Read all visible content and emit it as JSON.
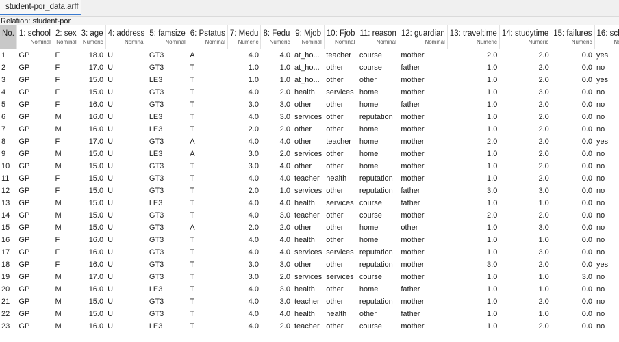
{
  "tab": {
    "label": "student-por_data.arff"
  },
  "relation": "Relation: student-por",
  "columns": [
    {
      "name": "No.",
      "type": ""
    },
    {
      "name": "1: school",
      "type": "Nominal"
    },
    {
      "name": "2: sex",
      "type": "Nominal"
    },
    {
      "name": "3: age",
      "type": "Numeric"
    },
    {
      "name": "4: address",
      "type": "Nominal"
    },
    {
      "name": "5: famsize",
      "type": "Nominal"
    },
    {
      "name": "6: Pstatus",
      "type": "Nominal"
    },
    {
      "name": "7: Medu",
      "type": "Numeric"
    },
    {
      "name": "8: Fedu",
      "type": "Numeric"
    },
    {
      "name": "9: Mjob",
      "type": "Nominal"
    },
    {
      "name": "10: Fjob",
      "type": "Nominal"
    },
    {
      "name": "11: reason",
      "type": "Nominal"
    },
    {
      "name": "12: guardian",
      "type": "Nominal"
    },
    {
      "name": "13: traveltime",
      "type": "Numeric"
    },
    {
      "name": "14: studytime",
      "type": "Numeric"
    },
    {
      "name": "15: failures",
      "type": "Numeric"
    },
    {
      "name": "16: scho",
      "type": "Nomi"
    }
  ],
  "rows": [
    [
      "1",
      "GP",
      "F",
      "18.0",
      "U",
      "GT3",
      "A",
      "4.0",
      "4.0",
      "at_ho...",
      "teacher",
      "course",
      "mother",
      "2.0",
      "2.0",
      "0.0",
      "yes"
    ],
    [
      "2",
      "GP",
      "F",
      "17.0",
      "U",
      "GT3",
      "T",
      "1.0",
      "1.0",
      "at_ho...",
      "other",
      "course",
      "father",
      "1.0",
      "2.0",
      "0.0",
      "no"
    ],
    [
      "3",
      "GP",
      "F",
      "15.0",
      "U",
      "LE3",
      "T",
      "1.0",
      "1.0",
      "at_ho...",
      "other",
      "other",
      "mother",
      "1.0",
      "2.0",
      "0.0",
      "yes"
    ],
    [
      "4",
      "GP",
      "F",
      "15.0",
      "U",
      "GT3",
      "T",
      "4.0",
      "2.0",
      "health",
      "services",
      "home",
      "mother",
      "1.0",
      "3.0",
      "0.0",
      "no"
    ],
    [
      "5",
      "GP",
      "F",
      "16.0",
      "U",
      "GT3",
      "T",
      "3.0",
      "3.0",
      "other",
      "other",
      "home",
      "father",
      "1.0",
      "2.0",
      "0.0",
      "no"
    ],
    [
      "6",
      "GP",
      "M",
      "16.0",
      "U",
      "LE3",
      "T",
      "4.0",
      "3.0",
      "services",
      "other",
      "reputation",
      "mother",
      "1.0",
      "2.0",
      "0.0",
      "no"
    ],
    [
      "7",
      "GP",
      "M",
      "16.0",
      "U",
      "LE3",
      "T",
      "2.0",
      "2.0",
      "other",
      "other",
      "home",
      "mother",
      "1.0",
      "2.0",
      "0.0",
      "no"
    ],
    [
      "8",
      "GP",
      "F",
      "17.0",
      "U",
      "GT3",
      "A",
      "4.0",
      "4.0",
      "other",
      "teacher",
      "home",
      "mother",
      "2.0",
      "2.0",
      "0.0",
      "yes"
    ],
    [
      "9",
      "GP",
      "M",
      "15.0",
      "U",
      "LE3",
      "A",
      "3.0",
      "2.0",
      "services",
      "other",
      "home",
      "mother",
      "1.0",
      "2.0",
      "0.0",
      "no"
    ],
    [
      "10",
      "GP",
      "M",
      "15.0",
      "U",
      "GT3",
      "T",
      "3.0",
      "4.0",
      "other",
      "other",
      "home",
      "mother",
      "1.0",
      "2.0",
      "0.0",
      "no"
    ],
    [
      "11",
      "GP",
      "F",
      "15.0",
      "U",
      "GT3",
      "T",
      "4.0",
      "4.0",
      "teacher",
      "health",
      "reputation",
      "mother",
      "1.0",
      "2.0",
      "0.0",
      "no"
    ],
    [
      "12",
      "GP",
      "F",
      "15.0",
      "U",
      "GT3",
      "T",
      "2.0",
      "1.0",
      "services",
      "other",
      "reputation",
      "father",
      "3.0",
      "3.0",
      "0.0",
      "no"
    ],
    [
      "13",
      "GP",
      "M",
      "15.0",
      "U",
      "LE3",
      "T",
      "4.0",
      "4.0",
      "health",
      "services",
      "course",
      "father",
      "1.0",
      "1.0",
      "0.0",
      "no"
    ],
    [
      "14",
      "GP",
      "M",
      "15.0",
      "U",
      "GT3",
      "T",
      "4.0",
      "3.0",
      "teacher",
      "other",
      "course",
      "mother",
      "2.0",
      "2.0",
      "0.0",
      "no"
    ],
    [
      "15",
      "GP",
      "M",
      "15.0",
      "U",
      "GT3",
      "A",
      "2.0",
      "2.0",
      "other",
      "other",
      "home",
      "other",
      "1.0",
      "3.0",
      "0.0",
      "no"
    ],
    [
      "16",
      "GP",
      "F",
      "16.0",
      "U",
      "GT3",
      "T",
      "4.0",
      "4.0",
      "health",
      "other",
      "home",
      "mother",
      "1.0",
      "1.0",
      "0.0",
      "no"
    ],
    [
      "17",
      "GP",
      "F",
      "16.0",
      "U",
      "GT3",
      "T",
      "4.0",
      "4.0",
      "services",
      "services",
      "reputation",
      "mother",
      "1.0",
      "3.0",
      "0.0",
      "no"
    ],
    [
      "18",
      "GP",
      "F",
      "16.0",
      "U",
      "GT3",
      "T",
      "3.0",
      "3.0",
      "other",
      "other",
      "reputation",
      "mother",
      "3.0",
      "2.0",
      "0.0",
      "yes"
    ],
    [
      "19",
      "GP",
      "M",
      "17.0",
      "U",
      "GT3",
      "T",
      "3.0",
      "2.0",
      "services",
      "services",
      "course",
      "mother",
      "1.0",
      "1.0",
      "3.0",
      "no"
    ],
    [
      "20",
      "GP",
      "M",
      "16.0",
      "U",
      "LE3",
      "T",
      "4.0",
      "3.0",
      "health",
      "other",
      "home",
      "father",
      "1.0",
      "1.0",
      "0.0",
      "no"
    ],
    [
      "21",
      "GP",
      "M",
      "15.0",
      "U",
      "GT3",
      "T",
      "4.0",
      "3.0",
      "teacher",
      "other",
      "reputation",
      "mother",
      "1.0",
      "2.0",
      "0.0",
      "no"
    ],
    [
      "22",
      "GP",
      "M",
      "15.0",
      "U",
      "GT3",
      "T",
      "4.0",
      "4.0",
      "health",
      "health",
      "other",
      "father",
      "1.0",
      "1.0",
      "0.0",
      "no"
    ],
    [
      "23",
      "GP",
      "M",
      "16.0",
      "U",
      "LE3",
      "T",
      "4.0",
      "2.0",
      "teacher",
      "other",
      "course",
      "mother",
      "1.0",
      "2.0",
      "0.0",
      "no"
    ]
  ]
}
